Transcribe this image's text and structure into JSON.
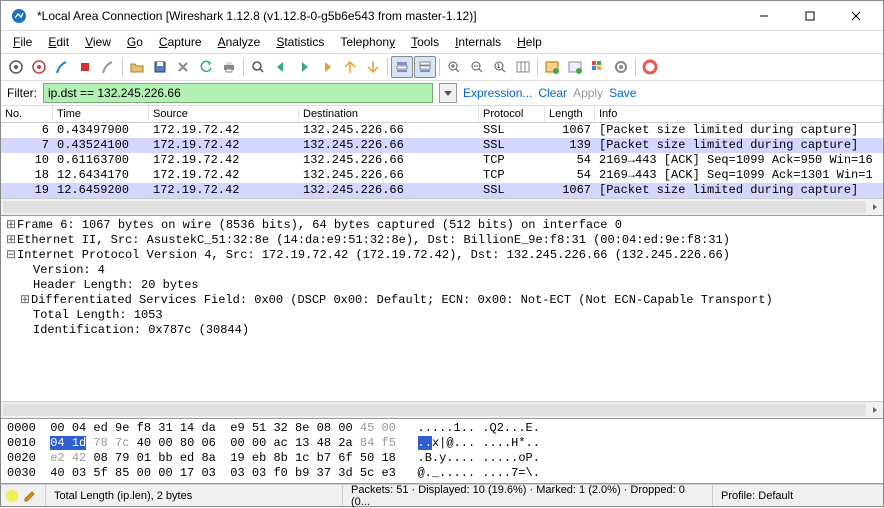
{
  "window": {
    "title": "*Local Area Connection   [Wireshark 1.12.8  (v1.12.8-0-g5b6e543 from master-1.12)]"
  },
  "menu": {
    "file": "File",
    "edit": "Edit",
    "view": "View",
    "go": "Go",
    "capture": "Capture",
    "analyze": "Analyze",
    "statistics": "Statistics",
    "telephony": "Telephony",
    "tools": "Tools",
    "internals": "Internals",
    "help": "Help"
  },
  "filter": {
    "label": "Filter:",
    "value": "ip.dst == 132.245.226.66",
    "expression": "Expression...",
    "clear": "Clear",
    "apply": "Apply",
    "save": "Save"
  },
  "columns": {
    "no": "No.",
    "time": "Time",
    "source": "Source",
    "destination": "Destination",
    "protocol": "Protocol",
    "length": "Length",
    "info": "Info"
  },
  "packets": [
    {
      "no": "6",
      "time": "0.43497900",
      "src": "172.19.72.42",
      "dst": "132.245.226.66",
      "proto": "SSL",
      "len": "1067",
      "info": "[Packet size limited during capture]",
      "sel": false
    },
    {
      "no": "7",
      "time": "0.43524100",
      "src": "172.19.72.42",
      "dst": "132.245.226.66",
      "proto": "SSL",
      "len": "139",
      "info": "[Packet size limited during capture]",
      "sel": true
    },
    {
      "no": "10",
      "time": "0.61163700",
      "src": "172.19.72.42",
      "dst": "132.245.226.66",
      "proto": "TCP",
      "len": "54",
      "info": "2169→443 [ACK] Seq=1099 Ack=950 Win=16",
      "sel": false
    },
    {
      "no": "18",
      "time": "12.6434170",
      "src": "172.19.72.42",
      "dst": "132.245.226.66",
      "proto": "TCP",
      "len": "54",
      "info": "2169→443 [ACK] Seq=1099 Ack=1301 Win=1",
      "sel": false
    },
    {
      "no": "19",
      "time": "12.6459200",
      "src": "172.19.72.42",
      "dst": "132.245.226.66",
      "proto": "SSL",
      "len": "1067",
      "info": "[Packet size limited during capture]",
      "sel": true
    }
  ],
  "tree": {
    "l0": "Frame 6: 1067 bytes on wire (8536 bits), 64 bytes captured (512 bits) on interface 0",
    "l1": "Ethernet II, Src: AsustekC_51:32:8e (14:da:e9:51:32:8e), Dst: BillionE_9e:f8:31 (00:04:ed:9e:f8:31)",
    "l2": "Internet Protocol Version 4, Src: 172.19.72.42 (172.19.72.42), Dst: 132.245.226.66 (132.245.226.66)",
    "l3": "Version: 4",
    "l4": "Header Length: 20 bytes",
    "l5": "Differentiated Services Field: 0x00 (DSCP 0x00: Default; ECN: 0x00: Not-ECT (Not ECN-Capable Transport)",
    "l6": "Total Length: 1053",
    "l7": "Identification: 0x787c (30844)"
  },
  "hex": {
    "r0_off": "0000",
    "r0_h": "00 04 ed 9e f8 31 14 da  e9 51 32 8e 08 00 ",
    "r0_hd": "45 00",
    "r0_a": ".....1.. .Q2...E.",
    "r1_off": "0010",
    "r1_sel": "04 1d",
    "r1_hd1": " 78 7c ",
    "r1_h": "40 00 80 06  00 00 ac 13 48 2a ",
    "r1_hd2": "84 f5",
    "r1_a1": "..",
    "r1_a2": "x|@... ....H*..",
    "r2_off": "0020",
    "r2_hd": "e2 42 ",
    "r2_h": "08 79 01 bb ed 8a  19 eb 8b 1c b7 6f 50 18",
    "r2_a": ".B.y.... .....oP.",
    "r3_off": "0030",
    "r3_h": "40 03 5f 85 00 00 17 03  03 03 f0 b9 37 3d 5c e3",
    "r3_a": "@._..... ....7=\\."
  },
  "status": {
    "field": "Total Length (ip.len), 2 bytes",
    "packets": "Packets: 51 · Displayed: 10 (19.6%) · Marked: 1 (2.0%) · Dropped: 0 (0...",
    "profile": "Profile: Default"
  }
}
